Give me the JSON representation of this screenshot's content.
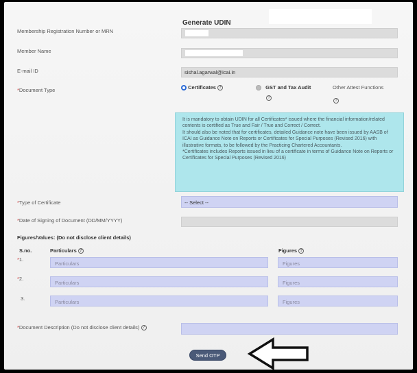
{
  "page": {
    "title": "Generate UDIN"
  },
  "fields": {
    "mrn_label": "Membership Registration Number or MRN",
    "member_name_label": "Member Name",
    "email_label": "E-mail ID",
    "email_value": "sishal.agarwal@icai.in",
    "doc_type_label": "Document Type"
  },
  "doc_type": {
    "options": [
      {
        "label": "Certificates",
        "selected": true
      },
      {
        "label": "GST and Tax Audit",
        "selected": false
      },
      {
        "label": "Other Attest Functions",
        "selected": false
      }
    ]
  },
  "info": {
    "p1": "It is mandatory to obtain UDIN for all Certificates* issued where the financial information/related contents is certified as True and Fair / True and Correct / Correct.",
    "p2": "It should also be noted that for certificates, detailed Guidance note have been issued by AASB of ICAI as Guidance Note on Reports or Certificates for Special Purposes (Revised 2016) with illustrative formats, to be followed by the Practicing Chartered Accountants.",
    "p3": "*Certificates includes Reports issued in lieu of a certificate in terms of Guidance Note on Reports or Certificates for Special Purposes (Revised 2016)"
  },
  "certificate": {
    "type_label": "Type of Certificate",
    "type_selected": "-- Select --",
    "date_label": "Date of Signing of Document (DD/MM/YYYY)"
  },
  "figures": {
    "section_label": "Figures/Values: (Do not disclose client details)",
    "col_sno": "S.no.",
    "col_particulars": "Particulars",
    "col_figures": "Figures",
    "rows": [
      {
        "sno": "1.",
        "required": true,
        "particulars_placeholder": "Particulars",
        "figures_placeholder": "Figures"
      },
      {
        "sno": "2.",
        "required": true,
        "particulars_placeholder": "Particulars",
        "figures_placeholder": "Figures"
      },
      {
        "sno": "3.",
        "required": false,
        "particulars_placeholder": "Particulars",
        "figures_placeholder": "Figures"
      }
    ]
  },
  "description": {
    "label": "Document Description (Do not disclose client details)"
  },
  "actions": {
    "send_otp": "Send OTP"
  },
  "icons": {
    "help": "?",
    "req": "*"
  }
}
